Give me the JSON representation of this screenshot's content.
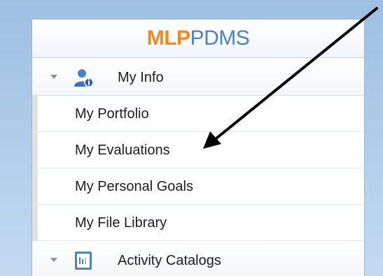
{
  "brand": {
    "logo_part1": "MLP",
    "logo_part2": "PDMS"
  },
  "sections": [
    {
      "label": "My Info",
      "icon": "user-info-icon"
    },
    {
      "label": "Activity Catalogs",
      "icon": "catalog-icon"
    }
  ],
  "my_info_items": [
    {
      "label": "My Portfolio"
    },
    {
      "label": "My Evaluations"
    },
    {
      "label": "My Personal Goals"
    },
    {
      "label": "My File Library"
    }
  ],
  "colors": {
    "logo_orange": "#f08a20",
    "logo_blue": "#4d7fc4",
    "background": "#a8c6e4"
  }
}
